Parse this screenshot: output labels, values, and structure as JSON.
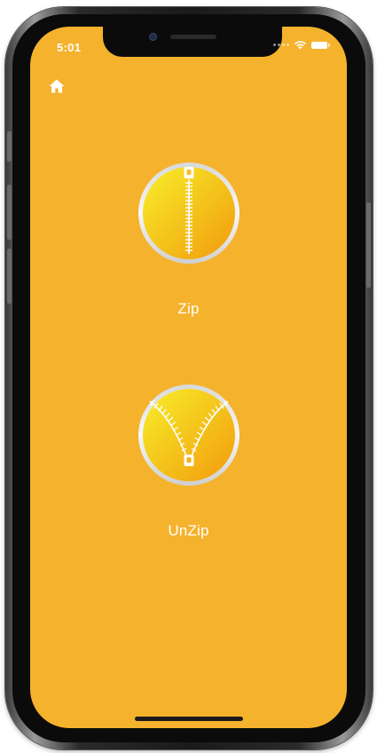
{
  "status_bar": {
    "time": "5:01",
    "wifi_icon": "wifi-icon",
    "battery_icon": "battery-icon"
  },
  "nav": {
    "home_icon": "home-icon"
  },
  "actions": [
    {
      "label": "Zip",
      "icon": "zipper-closed-icon"
    },
    {
      "label": "UnZip",
      "icon": "zipper-open-icon"
    }
  ],
  "colors": {
    "background": "#F5B22C",
    "text": "#FFFFFF",
    "icon_gradient_start": "#F7EF2A",
    "icon_gradient_end": "#F29A0D",
    "icon_ring": "#E6E6E6"
  }
}
